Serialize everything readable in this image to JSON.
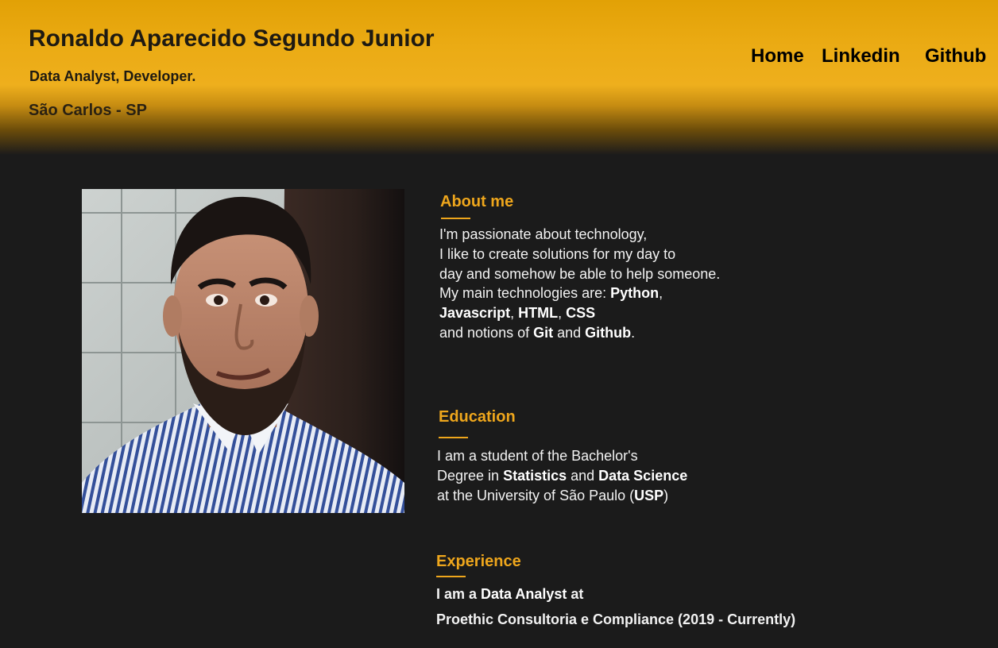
{
  "header": {
    "name": "Ronaldo Aparecido Segundo Junior",
    "role": "Data Analyst, Developer.",
    "location": "São Carlos - SP",
    "nav": {
      "home": "Home",
      "linkedin": "Linkedin",
      "github": "Github"
    }
  },
  "about": {
    "title": "About me",
    "line1": "I'm passionate about technology,",
    "line2": "I like to create solutions for my day to",
    "line3": "day and somehow be able to help someone.",
    "line4_prefix": "My main technologies are: ",
    "tech_python": "Python",
    "comma1": ",",
    "tech_javascript": "Javascript",
    "comma2": ", ",
    "tech_html": "HTML",
    "comma3": ", ",
    "tech_css": "CSS",
    "line6_prefix": "and notions of ",
    "tech_git": "Git",
    "and_word": " and ",
    "tech_github": "Github",
    "period": "."
  },
  "education": {
    "title": "Education",
    "line1": "I am a student of the Bachelor's",
    "line2_prefix": "Degree in ",
    "field1": "Statistics",
    "and_word": " and ",
    "field2": "Data Science",
    "line3_prefix": "at the University of São Paulo (",
    "university_abbr": "USP",
    "line3_suffix": ")"
  },
  "experience": {
    "title": "Experience",
    "line1_prefix": "I am a ",
    "position": "Data Analyst",
    "line1_suffix": " at",
    "company_line": "Proethic Consultoria e Compliance (2019 - Currently)"
  },
  "colors": {
    "accent": "#eea61c",
    "header_gold": "#ebab14",
    "background": "#1b1b1b",
    "text": "#f2f2f2"
  }
}
